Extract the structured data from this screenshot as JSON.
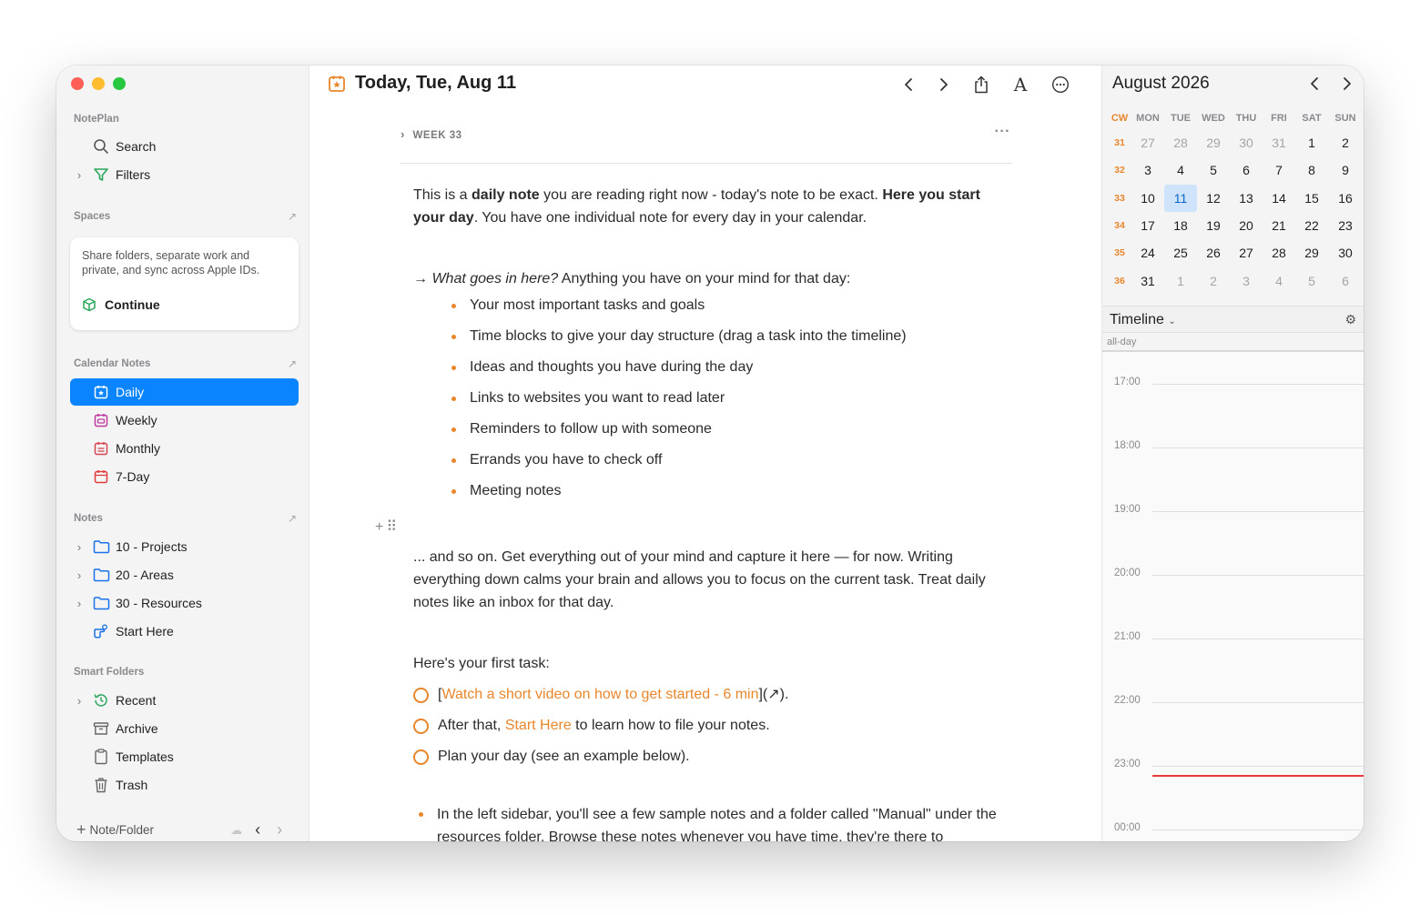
{
  "window": {
    "title": "Today, Tue, Aug 11"
  },
  "sidebar": {
    "app_label": "NotePlan",
    "search_label": "Search",
    "filters_label": "Filters",
    "spaces_label": "Spaces",
    "spaces_card_text": "Share folders, separate work and private, and sync across Apple IDs.",
    "spaces_continue": "Continue",
    "calendar_label": "Calendar Notes",
    "calendar_items": [
      {
        "label": "Daily"
      },
      {
        "label": "Weekly"
      },
      {
        "label": "Monthly"
      },
      {
        "label": "7-Day"
      }
    ],
    "notes_label": "Notes",
    "notes_items": [
      {
        "label": "10 - Projects"
      },
      {
        "label": "20 - Areas"
      },
      {
        "label": "30 - Resources"
      },
      {
        "label": "Start Here"
      }
    ],
    "smart_label": "Smart Folders",
    "smart_items": [
      {
        "label": "Recent"
      },
      {
        "label": "Archive"
      },
      {
        "label": "Templates"
      },
      {
        "label": "Trash"
      }
    ],
    "footer_add": "Note/Folder"
  },
  "editor": {
    "week_label": "WEEK 33",
    "intro_1": "This is a ",
    "intro_bold_1": "daily note",
    "intro_2": " you are reading right now - today's note to be exact. ",
    "intro_bold_2": "Here you start your day",
    "intro_3": ". You have one individual note for every day in your calendar.",
    "what_arrow": "→ ",
    "what_italic": "What goes in here?",
    "what_rest": " Anything you have on your mind for that day:",
    "bullets": [
      "Your most important tasks and goals",
      "Time blocks to give your day structure (drag a task into the timeline)",
      "Ideas and thoughts you have during the day",
      "Links to websites you want to read later",
      "Reminders to follow up with someone",
      "Errands you have to check off",
      "Meeting notes"
    ],
    "andso": "... and so on. Get everything out of your mind and capture it here — for now. Writing everything down calms your brain and allows you to focus on the current task. Treat daily notes like an inbox for that day.",
    "first_task": "Here's your first task:",
    "task1_pre": "[",
    "task1_link": "Watch a short video on how to get started - 6 min",
    "task1_post": "](↗).",
    "task2_pre": "After that, ",
    "task2_link": "Start Here",
    "task2_post": " to learn how to file your notes.",
    "task3": "Plan your day (see an example below).",
    "last_bullet": "In the left sidebar, you'll see a few sample notes and a folder called \"Manual\" under the resources folder. Browse these notes whenever you have time, they're there to"
  },
  "calendar": {
    "month_title": "August 2026",
    "headers": [
      "CW",
      "MON",
      "TUE",
      "WED",
      "THU",
      "FRI",
      "SAT",
      "SUN"
    ],
    "weeks": [
      {
        "cw": "31",
        "days": [
          "27",
          "28",
          "29",
          "30",
          "31",
          "1",
          "2"
        ],
        "dim": [
          true,
          true,
          true,
          true,
          true,
          false,
          false
        ]
      },
      {
        "cw": "32",
        "days": [
          "3",
          "4",
          "5",
          "6",
          "7",
          "8",
          "9"
        ],
        "dim": [
          false,
          false,
          false,
          false,
          false,
          false,
          false
        ]
      },
      {
        "cw": "33",
        "days": [
          "10",
          "11",
          "12",
          "13",
          "14",
          "15",
          "16"
        ],
        "dim": [
          false,
          false,
          false,
          false,
          false,
          false,
          false
        ]
      },
      {
        "cw": "34",
        "days": [
          "17",
          "18",
          "19",
          "20",
          "21",
          "22",
          "23"
        ],
        "dim": [
          false,
          false,
          false,
          false,
          false,
          false,
          false
        ]
      },
      {
        "cw": "35",
        "days": [
          "24",
          "25",
          "26",
          "27",
          "28",
          "29",
          "30"
        ],
        "dim": [
          false,
          false,
          false,
          false,
          false,
          false,
          false
        ]
      },
      {
        "cw": "36",
        "days": [
          "31",
          "1",
          "2",
          "3",
          "4",
          "5",
          "6"
        ],
        "dim": [
          false,
          true,
          true,
          true,
          true,
          true,
          true
        ]
      }
    ],
    "today": "11"
  },
  "timeline": {
    "title": "Timeline",
    "allday": "all-day",
    "hours": [
      "17:00",
      "18:00",
      "19:00",
      "20:00",
      "21:00",
      "22:00",
      "23:00",
      "00:00"
    ]
  },
  "colors": {
    "accent": "#e8862b",
    "selection": "#0a84ff",
    "now_line": "#e63a3a"
  }
}
